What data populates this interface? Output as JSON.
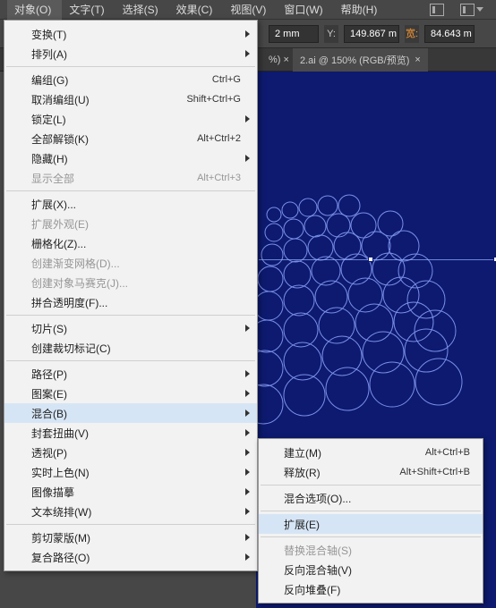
{
  "menubar": {
    "items": [
      "对象(O)",
      "文字(T)",
      "选择(S)",
      "效果(C)",
      "视图(V)",
      "窗口(W)",
      "帮助(H)"
    ],
    "active_index": 0
  },
  "prop_bar": {
    "field1_suffix": "2 mm",
    "y_label": "Y:",
    "y_value": "149.867 m",
    "w_label": "宽:",
    "w_value": "84.643 m"
  },
  "tab_bar": {
    "left_fragment": "%) ×",
    "tab_label": "2.ai @ 150% (RGB/预览)",
    "close": "×"
  },
  "dropdown": {
    "items": [
      {
        "label": "变换(T)",
        "submenu": true
      },
      {
        "label": "排列(A)",
        "submenu": true
      },
      {
        "sep": true
      },
      {
        "label": "编组(G)",
        "shortcut": "Ctrl+G"
      },
      {
        "label": "取消编组(U)",
        "shortcut": "Shift+Ctrl+G"
      },
      {
        "label": "锁定(L)",
        "submenu": true
      },
      {
        "label": "全部解锁(K)",
        "shortcut": "Alt+Ctrl+2"
      },
      {
        "label": "隐藏(H)",
        "submenu": true
      },
      {
        "label": "显示全部",
        "shortcut": "Alt+Ctrl+3",
        "disabled": true
      },
      {
        "sep": true
      },
      {
        "label": "扩展(X)..."
      },
      {
        "label": "扩展外观(E)",
        "disabled": true
      },
      {
        "label": "栅格化(Z)..."
      },
      {
        "label": "创建渐变网格(D)...",
        "disabled": true
      },
      {
        "label": "创建对象马赛克(J)...",
        "disabled": true
      },
      {
        "label": "拼合透明度(F)..."
      },
      {
        "sep": true
      },
      {
        "label": "切片(S)",
        "submenu": true
      },
      {
        "label": "创建裁切标记(C)"
      },
      {
        "sep": true
      },
      {
        "label": "路径(P)",
        "submenu": true
      },
      {
        "label": "图案(E)",
        "submenu": true
      },
      {
        "label": "混合(B)",
        "submenu": true,
        "highlight": true
      },
      {
        "label": "封套扭曲(V)",
        "submenu": true
      },
      {
        "label": "透视(P)",
        "submenu": true
      },
      {
        "label": "实时上色(N)",
        "submenu": true
      },
      {
        "label": "图像描摹",
        "submenu": true
      },
      {
        "label": "文本绕排(W)",
        "submenu": true
      },
      {
        "sep": true
      },
      {
        "label": "剪切蒙版(M)",
        "submenu": true
      },
      {
        "label": "复合路径(O)",
        "submenu": true
      }
    ]
  },
  "submenu": {
    "items": [
      {
        "label": "建立(M)",
        "shortcut": "Alt+Ctrl+B"
      },
      {
        "label": "释放(R)",
        "shortcut": "Alt+Shift+Ctrl+B"
      },
      {
        "sep": true
      },
      {
        "label": "混合选项(O)..."
      },
      {
        "sep": true
      },
      {
        "label": "扩展(E)",
        "highlight": true
      },
      {
        "sep": true
      },
      {
        "label": "替换混合轴(S)",
        "disabled": true
      },
      {
        "label": "反向混合轴(V)"
      },
      {
        "label": "反向堆叠(F)"
      }
    ]
  }
}
